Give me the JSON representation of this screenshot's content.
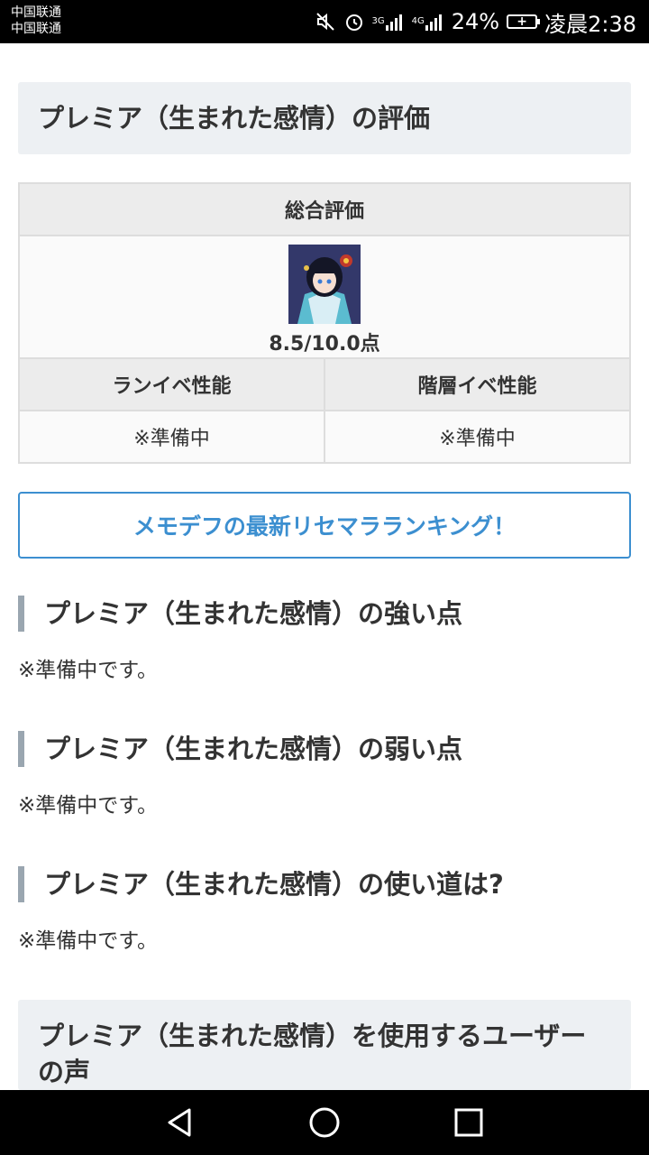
{
  "status_bar": {
    "carrier_1": "中国联通",
    "carrier_2": "中国联通",
    "network_1": "3G",
    "network_2": "4G",
    "battery_percent": "24%",
    "time": "凌晨2:38",
    "icons": [
      "mute-icon",
      "alarm-icon",
      "signal-icon",
      "signal-icon",
      "battery-icon"
    ]
  },
  "page": {
    "title": "プレミア（生まれた感情）の評価",
    "rating_table": {
      "header": "総合評価",
      "score": "8.5/10.0点",
      "col1_header": "ランイベ性能",
      "col2_header": "階層イベ性能",
      "col1_value": "※準備中",
      "col2_value": "※準備中"
    },
    "cta_label": "メモデフの最新リセマラランキング！",
    "sections": [
      {
        "title": "プレミア（生まれた感情）の強い点",
        "body": "※準備中です。"
      },
      {
        "title": "プレミア（生まれた感情）の弱い点",
        "body": "※準備中です。"
      },
      {
        "title": "プレミア（生まれた感情）の使い道は?",
        "body": "※準備中です。"
      }
    ],
    "bottom_heading": "プレミア（生まれた感情）を使用するユーザーの声"
  },
  "colors": {
    "accent": "#3c8fd0",
    "heading_bg": "#edf0f3",
    "section_bar": "#9aa6b0"
  },
  "nav_bar": {
    "icons": [
      "back-icon",
      "home-icon",
      "recents-icon"
    ]
  }
}
